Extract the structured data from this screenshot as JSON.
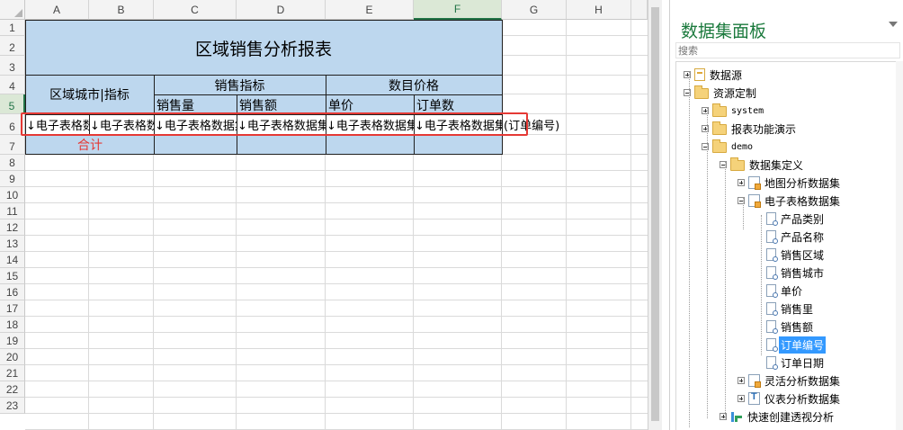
{
  "spreadsheet": {
    "columns": [
      "A",
      "B",
      "C",
      "D",
      "E",
      "F",
      "G",
      "H"
    ],
    "selected_column": "F",
    "rows": [
      "1",
      "2",
      "3",
      "4",
      "5",
      "6",
      "7",
      "8",
      "9",
      "10",
      "11",
      "12",
      "13",
      "14",
      "15",
      "16",
      "17",
      "18",
      "19",
      "20",
      "21",
      "22",
      "23"
    ],
    "selected_row": "5",
    "title": "区域销售分析报表",
    "header_region_city": "区域城市|指标",
    "group_sales": "销售指标",
    "group_price": "数目价格",
    "sub_qty": "销售量",
    "sub_amount": "销售额",
    "sub_unit_price": "单价",
    "sub_order_count": "订单数",
    "row5_a": "↓电子表格数",
    "row5_b": "↓电子表格数",
    "row5_c": "↓电子表格数据集",
    "row5_d": "↓电子表格数据集",
    "row5_e": "↓电子表格数据集",
    "row5_f": "↓电子表格数据集",
    "row5_overflow": "(订单编号)",
    "total_label": "合计",
    "colors": {
      "header_blue": "#bdd7ee",
      "highlight_red": "#e53935",
      "select_green": "#217346"
    }
  },
  "panel": {
    "title": "数据集面板",
    "search_placeholder": "搜索",
    "tree": [
      {
        "label": "数据源",
        "icon": "datasource-icon",
        "expander": "plus"
      },
      {
        "label": "资源定制",
        "icon": "folder-icon",
        "expander": "minus"
      },
      {
        "label": "system",
        "icon": "folder-icon",
        "expander": "plus"
      },
      {
        "label": "报表功能演示",
        "icon": "folder-icon",
        "expander": "plus"
      },
      {
        "label": "demo",
        "icon": "folder-icon",
        "expander": "minus"
      },
      {
        "label": "数据集定义",
        "icon": "folder-icon",
        "expander": "minus"
      },
      {
        "label": "地图分析数据集",
        "icon": "dataset-icon",
        "expander": "plus"
      },
      {
        "label": "电子表格数据集",
        "icon": "dataset-icon",
        "expander": "minus"
      },
      {
        "label": "产品类别",
        "icon": "field-icon"
      },
      {
        "label": "产品名称",
        "icon": "field-icon"
      },
      {
        "label": "销售区域",
        "icon": "field-icon"
      },
      {
        "label": "销售城市",
        "icon": "field-icon"
      },
      {
        "label": "单价",
        "icon": "field-icon"
      },
      {
        "label": "销售里",
        "icon": "field-icon"
      },
      {
        "label": "销售额",
        "icon": "field-icon"
      },
      {
        "label": "订单编号",
        "icon": "field-icon",
        "selected": true
      },
      {
        "label": "订单日期",
        "icon": "field-icon"
      },
      {
        "label": "灵活分析数据集",
        "icon": "dataset-icon",
        "expander": "plus"
      },
      {
        "label": "仪表分析数据集",
        "icon": "dashboard-icon",
        "expander": "plus"
      },
      {
        "label": "快速创建透视分析",
        "icon": "pivot-icon",
        "expander": "plus"
      }
    ]
  }
}
